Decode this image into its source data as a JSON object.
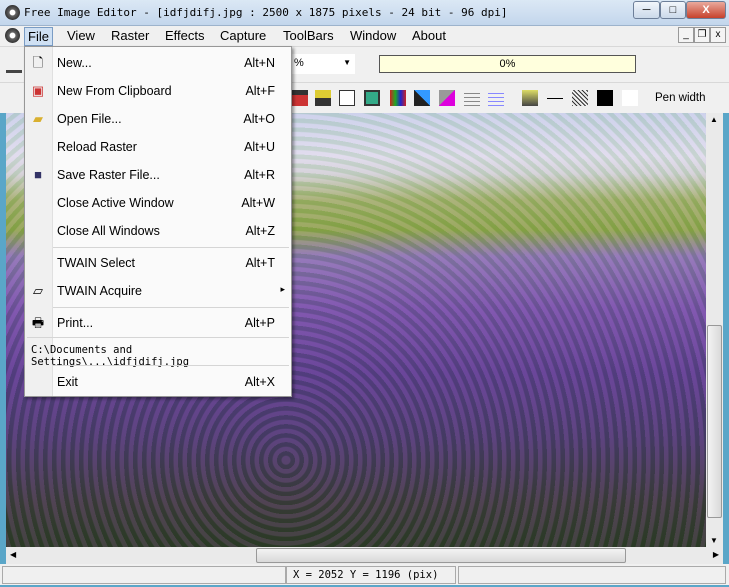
{
  "window": {
    "title": "Free Image Editor - [idfjdifj.jpg : 2500 x 1875 pixels - 24 bit - 96 dpi]",
    "minimize": "─",
    "maximize": "□",
    "close": "X"
  },
  "menubar": {
    "items": [
      "File",
      "View",
      "Raster",
      "Effects",
      "Capture",
      "ToolBars",
      "Window",
      "About"
    ],
    "mdi_min": "_",
    "mdi_restore": "❐",
    "mdi_close": "x"
  },
  "toolbar": {
    "zoom_value": "%",
    "progress_text": "0%",
    "progress": 0,
    "pen_width_label": "Pen width"
  },
  "file_menu": {
    "items": [
      {
        "label": "New...",
        "shortcut": "Alt+N",
        "icon": "new-file-icon"
      },
      {
        "label": "New From Clipboard",
        "shortcut": "Alt+F",
        "icon": "clipboard-icon"
      },
      {
        "label": "Open File...",
        "shortcut": "Alt+O",
        "icon": "folder-open-icon"
      },
      {
        "label": "Reload Raster",
        "shortcut": "Alt+U"
      },
      {
        "label": "Save Raster File...",
        "shortcut": "Alt+R",
        "icon": "floppy-icon"
      },
      {
        "label": "Close Active Window",
        "shortcut": "Alt+W"
      },
      {
        "label": "Close All Windows",
        "shortcut": "Alt+Z"
      },
      {
        "label": "TWAIN Select",
        "shortcut": "Alt+T"
      },
      {
        "label": "TWAIN Acquire",
        "shortcut": "▸",
        "icon": "scanner-icon"
      },
      {
        "label": "Print...",
        "shortcut": "Alt+P",
        "icon": "printer-icon"
      },
      {
        "label": "Exit",
        "shortcut": "Alt+X"
      }
    ],
    "recent_file": "C:\\Documents and Settings\\...\\idfjdifj.jpg"
  },
  "status": {
    "coords": "X = 2052   Y = 1196  (pix)"
  },
  "colors": {
    "progress_bg": "#ffffdd",
    "title_bg": "#c3d6ec"
  }
}
